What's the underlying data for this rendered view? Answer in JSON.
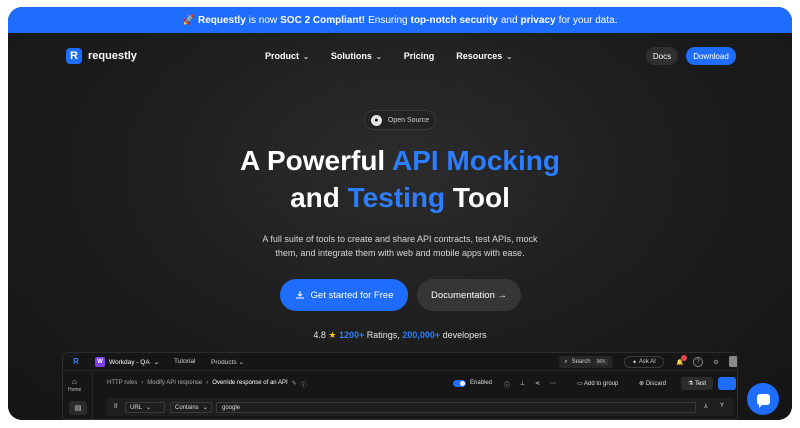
{
  "banner": {
    "emoji": "🚀",
    "brand": "Requestly",
    "is_now": "is now",
    "cert": "SOC 2 Compliant!",
    "ensuring": "Ensuring",
    "security": "top-notch security",
    "and": "and",
    "privacy": "privacy",
    "tail": "for your data."
  },
  "nav": {
    "logo_text": "requestly",
    "logo_mark": "R",
    "items": [
      {
        "label": "Product",
        "chevron": "⌄"
      },
      {
        "label": "Solutions",
        "chevron": "⌄"
      },
      {
        "label": "Pricing",
        "chevron": ""
      },
      {
        "label": "Resources",
        "chevron": "⌄"
      }
    ],
    "docs_label": "Docs",
    "download_label": "Download"
  },
  "hero": {
    "badge": "Open Source",
    "title_line1_a": "A Powerful",
    "title_line1_b": "API Mocking",
    "title_line2_a": "and",
    "title_line2_b": "Testing",
    "title_line2_c": "Tool",
    "subtitle_line1": "A full suite of tools to create and share API contracts, test APIs, mock",
    "subtitle_line2": "them, and integrate them with web and mobile apps with ease.",
    "cta_primary": "Get started for Free",
    "cta_secondary": "Documentation →",
    "rating_score": "4.8",
    "rating_star": "★",
    "rating_count": "1200+",
    "ratings_word": "Ratings,",
    "dev_count": "200,000+",
    "dev_word": "developers"
  },
  "app": {
    "workspace_badge": "W",
    "workspace": "Workday - QA",
    "tutorial": "Tutorial",
    "products": "Products",
    "search": "Search",
    "search_kbd": "⌘K",
    "ask_ai": "Ask AI",
    "side_home": "Home",
    "crumbs": [
      "HTTP rules",
      "›",
      "Modify API response",
      "›",
      "Override response of an API"
    ],
    "enabled": "Enabled",
    "add_to_group": "Add to group",
    "discard": "Discard",
    "test": "Test",
    "if_label": "If",
    "field": "URL",
    "operator": "Contains",
    "value": "google"
  },
  "colors": {
    "accent": "#1f6dff",
    "background": "#1b1b1b"
  }
}
